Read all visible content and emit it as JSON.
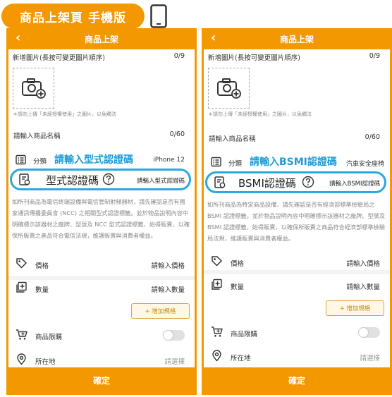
{
  "badge": {
    "title": "商品上架頁 手機版"
  },
  "common": {
    "nav_title": "商品上架",
    "back_glyph": "‹",
    "new_image_label": "新增圖片(長按可變更圖片順序)",
    "image_count": "0/9",
    "upload_hint": "＊請勿上傳「未經授權使用」之圖片，以免觸法",
    "name_label": "請輸入商品名稱",
    "name_count": "0/60",
    "category_label": "分類",
    "price_label": "價格",
    "price_placeholder": "請輸入價格",
    "qty_label": "數量",
    "qty_placeholder": "請輸入數量",
    "add_spec": "+ 增加規格",
    "limit_label": "商品限購",
    "location_label": "所在地",
    "location_placeholder": "請選擇",
    "confirm": "確定"
  },
  "left": {
    "annotation": "請輸入型式認證碼",
    "category_value": "iPhone 12",
    "cert_label": "型式認證碼",
    "cert_placeholder": "請輸入型式認證碼",
    "desc": "如所刊商品為電信終端設備與電信管制射頻器材，請先確認是否有國家通訊傳播委員會 (NCC) 之相關型式認證標籤。並於物品說明內容中明確標示該器材之廠牌、型號及 NCC 型式認證標籤，始得販賣，以確保所販賣之產品符合電信法規，維護販賣與消費者權益。"
  },
  "right": {
    "annotation": "請輸入BSMI認證碼",
    "category_value": "汽車安全座椅",
    "cert_label": "BSMI認證碼",
    "cert_placeholder": "請輸入BSMI認證碼",
    "desc": "如所刊商品為特定商品設備，請先確認是否有經濟部標準檢驗局之 BSMI 認證標籤。並於物品說明內容中明確標示該器材之廠牌、型號及 BSMI 認證標籤，始得販賣，以確保所販賣之商品符合經濟部標準檢驗局法規，維護販賣與消費者權益。"
  },
  "icons": [
    "phone-icon",
    "camera-icon",
    "list-icon",
    "certificate-icon",
    "help-icon",
    "tag-icon",
    "quantity-icon",
    "cart-icon",
    "location-icon"
  ],
  "colors": {
    "primary": "#f39800",
    "highlight": "#2aa8e0",
    "annotation": "#1e9bd7"
  }
}
